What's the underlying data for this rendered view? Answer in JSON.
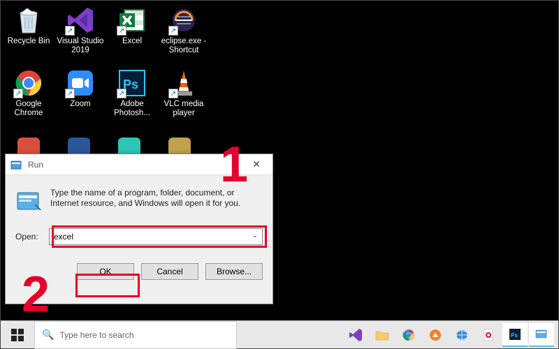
{
  "desktop_icons": [
    {
      "name": "Recycle Bin",
      "icon": "recycle-bin"
    },
    {
      "name": "Visual Studio 2019",
      "icon": "visual-studio"
    },
    {
      "name": "Excel",
      "icon": "excel"
    },
    {
      "name": "eclipse.exe - Shortcut",
      "icon": "eclipse"
    },
    {
      "name": "Google Chrome",
      "icon": "chrome"
    },
    {
      "name": "Zoom",
      "icon": "zoom"
    },
    {
      "name": "Adobe Photosh...",
      "icon": "photoshop"
    },
    {
      "name": "VLC media player",
      "icon": "vlc"
    }
  ],
  "run_dialog": {
    "title": "Run",
    "description": "Type the name of a program, folder, document, or Internet resource, and Windows will open it for you.",
    "open_label": "Open:",
    "open_value": "excel",
    "buttons": {
      "ok": "OK",
      "cancel": "Cancel",
      "browse": "Browse..."
    }
  },
  "annotations": {
    "one": "1",
    "two": "2"
  },
  "taskbar": {
    "search_placeholder": "Type here to search",
    "items": [
      {
        "name": "visual-studio"
      },
      {
        "name": "file-explorer"
      },
      {
        "name": "chrome"
      },
      {
        "name": "foxit"
      },
      {
        "name": "browser"
      },
      {
        "name": "pdf"
      },
      {
        "name": "photoshop"
      },
      {
        "name": "run"
      }
    ]
  }
}
